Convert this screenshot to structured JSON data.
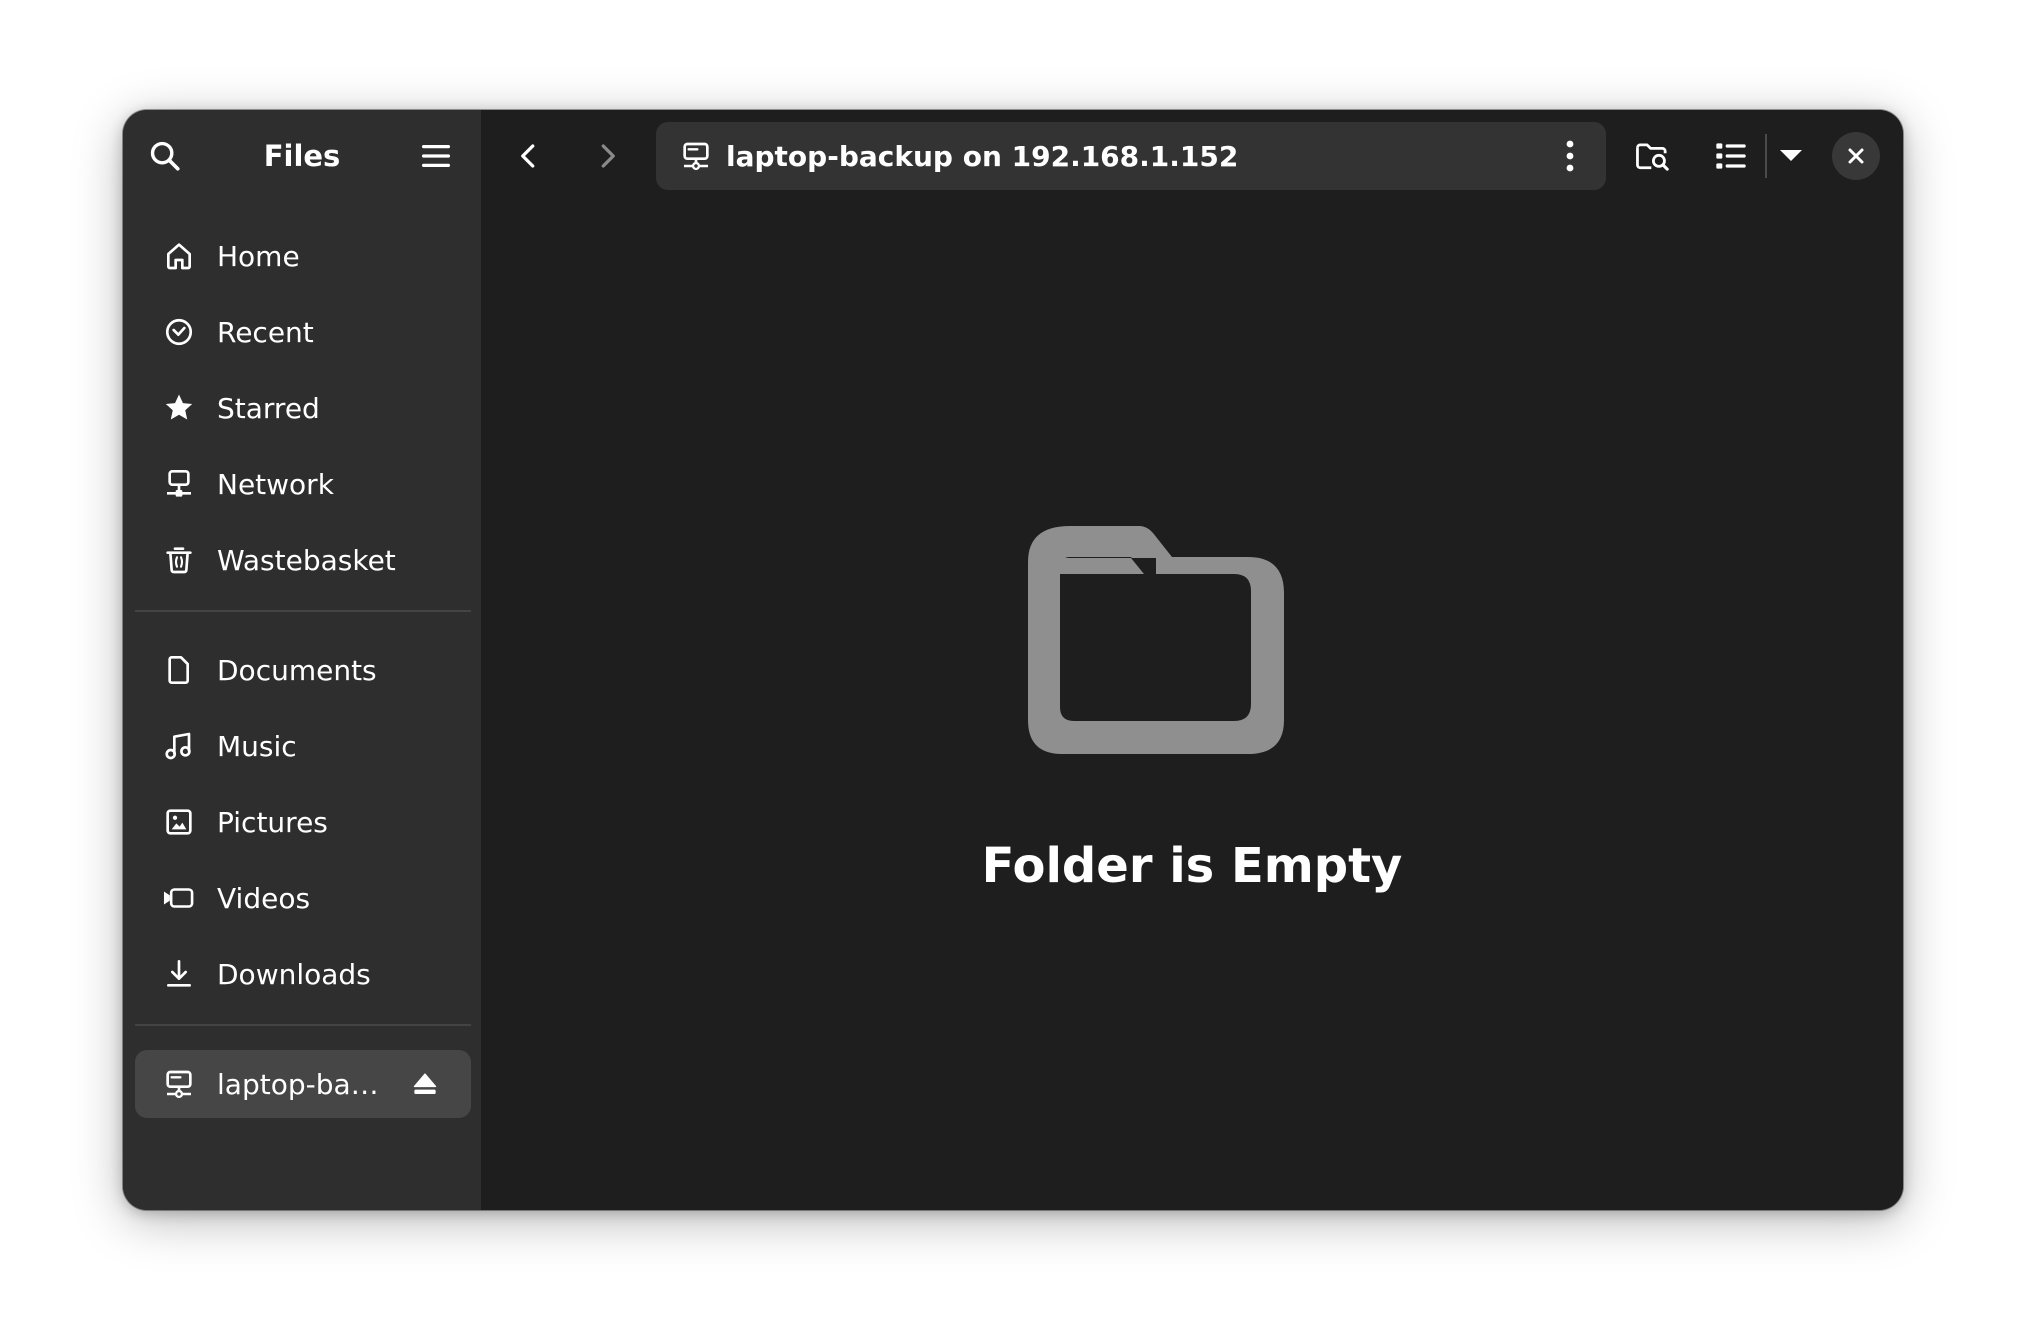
{
  "app": {
    "title": "Files"
  },
  "location": {
    "text": "laptop-backup on 192.168.1.152",
    "icon": "network-server-icon"
  },
  "sidebar": {
    "places": [
      {
        "label": "Home",
        "icon": "home-icon"
      },
      {
        "label": "Recent",
        "icon": "clock-icon"
      },
      {
        "label": "Starred",
        "icon": "star-icon"
      },
      {
        "label": "Network",
        "icon": "network-icon"
      },
      {
        "label": "Wastebasket",
        "icon": "trash-icon"
      }
    ],
    "bookmarks": [
      {
        "label": "Documents",
        "icon": "document-icon"
      },
      {
        "label": "Music",
        "icon": "music-icon"
      },
      {
        "label": "Pictures",
        "icon": "picture-icon"
      },
      {
        "label": "Videos",
        "icon": "video-icon"
      },
      {
        "label": "Downloads",
        "icon": "download-icon"
      }
    ],
    "mounts": [
      {
        "label": "laptop-ba…",
        "icon": "network-server-icon",
        "selected": true
      }
    ]
  },
  "empty_state": {
    "title": "Folder is Empty",
    "icon": "folder-icon"
  },
  "colors": {
    "sidebar_bg": "#2e2e2e",
    "main_bg": "#1e1e1e",
    "location_bg": "#333333",
    "selected_bg": "#464646",
    "text": "#ffffff",
    "empty_icon": "#8f8f8f"
  }
}
